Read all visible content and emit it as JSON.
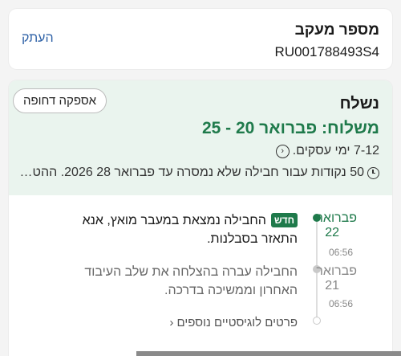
{
  "tracking": {
    "label": "מספר מעקב",
    "number": "RU001788493S4",
    "copy_label": "העתק"
  },
  "shipment": {
    "status": "נשלח",
    "urgent_label": "אספקה דחופה",
    "delivered": "משלוח: פברואר 20 - 25",
    "days": "7-12 ימי עסקים.",
    "points": "50 נקודות עבור חבילה שלא נמסרה עד פברואר 28 2026. ההטב..."
  },
  "events": [
    {
      "month": "פברואר",
      "day": "22",
      "time": "06:56",
      "badge": "חדש",
      "text": "החבילה נמצאת במעבר מואץ, אנא התאזר בסבלנות.",
      "status": "current"
    },
    {
      "month": "פברואר",
      "day": "21",
      "time": "06:56",
      "text": "החבילה עברה בהצלחה את שלב העיבוד האחרון וממשיכה בדרכה.",
      "status": "past"
    }
  ],
  "more_details": "פרטים לוגיסטיים נוספים",
  "colors": {
    "accent_green": "#1f7a4b",
    "link_blue": "#2f62a7",
    "header_bg": "#eaf4ee"
  },
  "icons": [
    "chevron-circle-icon",
    "clock-icon",
    "chevron-left-icon"
  ]
}
